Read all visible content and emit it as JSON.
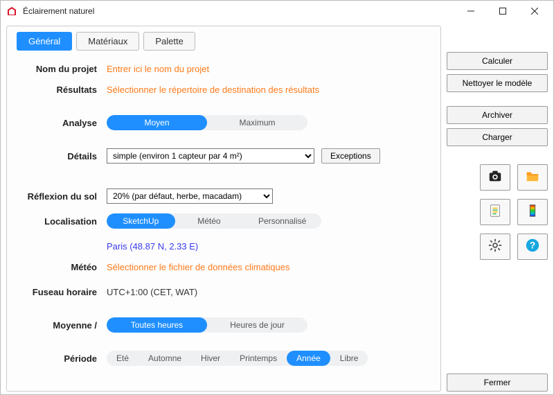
{
  "window": {
    "title": "Éclairement naturel"
  },
  "tabs": {
    "general": "Général",
    "materials": "Matériaux",
    "palette": "Palette"
  },
  "labels": {
    "projectName": "Nom du projet",
    "results": "Résultats",
    "analysis": "Analyse",
    "details": "Détails",
    "groundRefl": "Réflexion du sol",
    "localisation": "Localisation",
    "weather": "Météo",
    "timezone": "Fuseau horaire",
    "average": "Moyenne /",
    "period": "Période"
  },
  "placeholders": {
    "projectName": "Entrer ici le nom du projet",
    "results": "Sélectionner le répertoire de destination des résultats",
    "weather": "Sélectionner le fichier de données climatiques"
  },
  "analysis": {
    "avg": "Moyen",
    "max": "Maximum"
  },
  "details": {
    "select": "simple (environ 1 capteur par 4 m²)",
    "exceptions": "Exceptions"
  },
  "groundRefl": {
    "select": "20% (par défaut, herbe, macadam)"
  },
  "localisation": {
    "sketchup": "SketchUp",
    "meteo": "Météo",
    "custom": "Personnalisé",
    "place": "Paris   (48.87 N, 2.33 E)"
  },
  "timezone": {
    "value": "UTC+1:00 (CET, WAT)"
  },
  "average": {
    "allHours": "Toutes heures",
    "dayHours": "Heures de jour"
  },
  "period": {
    "summer": "Eté",
    "autumn": "Automne",
    "winter": "Hiver",
    "spring": "Printemps",
    "year": "Année",
    "free": "Libre"
  },
  "side": {
    "calculate": "Calculer",
    "clean": "Nettoyer le modèle",
    "archive": "Archiver",
    "load": "Charger",
    "close": "Fermer"
  }
}
